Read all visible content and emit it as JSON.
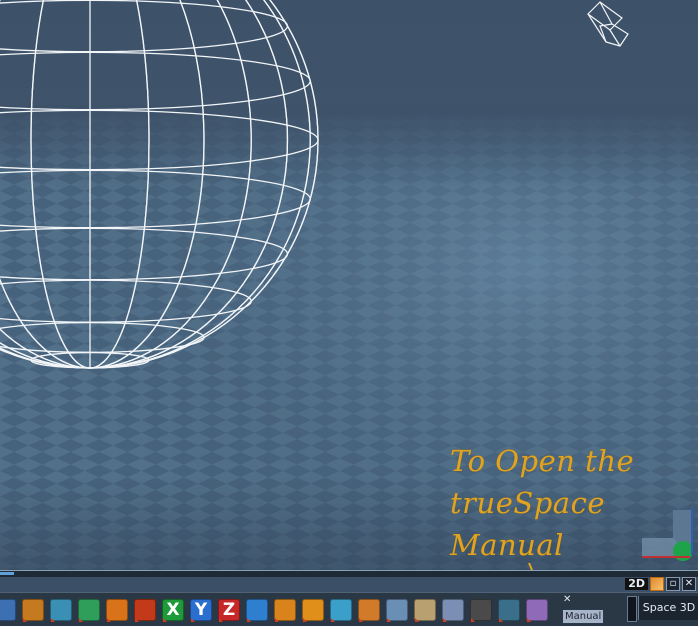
{
  "annotation": {
    "lines": [
      "To Open the",
      "trueSpace",
      "Manual"
    ],
    "color": "#e0a422"
  },
  "window_controls": {
    "view_2d_label": "2D",
    "paint_icon": "paint-brush-icon",
    "restore_icon": "restore-icon",
    "close_label": "✕"
  },
  "toolbar": {
    "tools": [
      {
        "name": "magnet-tool",
        "icon": "magnet-icon",
        "label": "",
        "color": "#3d6fb3"
      },
      {
        "name": "object-tool",
        "icon": "cube-icon",
        "label": "",
        "color": "#c57a1f"
      },
      {
        "name": "library-tool",
        "icon": "library-icon",
        "label": "",
        "color": "#3a8fb5"
      },
      {
        "name": "wire-tool",
        "icon": "wire-cube-icon",
        "label": "",
        "color": "#2f9e5a"
      },
      {
        "name": "home-tool",
        "icon": "home-icon",
        "label": "",
        "color": "#d9731a"
      },
      {
        "name": "move-tool",
        "icon": "move-axis-icon",
        "label": "",
        "color": "#c23a1a"
      },
      {
        "name": "x-axis-tool",
        "icon": "x-axis-icon",
        "label": "X",
        "color": "#1e9a3a"
      },
      {
        "name": "y-axis-tool",
        "icon": "y-axis-icon",
        "label": "Y",
        "color": "#2a6fcf"
      },
      {
        "name": "z-axis-tool",
        "icon": "z-axis-icon",
        "label": "Z",
        "color": "#c62828"
      },
      {
        "name": "rotate-tool",
        "icon": "rotate-icon",
        "label": "",
        "color": "#2f7fd1"
      },
      {
        "name": "scale-tool",
        "icon": "scale-icon",
        "label": "",
        "color": "#d8831c"
      },
      {
        "name": "sphere-tool",
        "icon": "sphere-icon",
        "label": "",
        "color": "#e0901a"
      },
      {
        "name": "cone-tool",
        "icon": "cone-icon",
        "label": "",
        "color": "#3aa0c9"
      },
      {
        "name": "texture-tool",
        "icon": "texture-icon",
        "label": "",
        "color": "#d07a2a"
      },
      {
        "name": "material-tool",
        "icon": "material-icon",
        "label": "",
        "color": "#6a8fb5"
      },
      {
        "name": "render-tool",
        "icon": "render-icon",
        "label": "",
        "color": "#b8a070"
      },
      {
        "name": "grid-tool",
        "icon": "grid-icon",
        "label": "",
        "color": "#7b8fb5"
      },
      {
        "name": "camera-tool",
        "icon": "camera-icon",
        "label": "",
        "color": "#4a4a4a"
      },
      {
        "name": "binoculars-tool",
        "icon": "binoculars-icon",
        "label": "",
        "color": "#3a6f8a"
      },
      {
        "name": "manual-tool",
        "icon": "manual-icon",
        "label": "",
        "color": "#8f6ab8"
      }
    ],
    "manual_tooltip": "Manual",
    "close_manual": "✕",
    "space_label": "Space 3D"
  }
}
